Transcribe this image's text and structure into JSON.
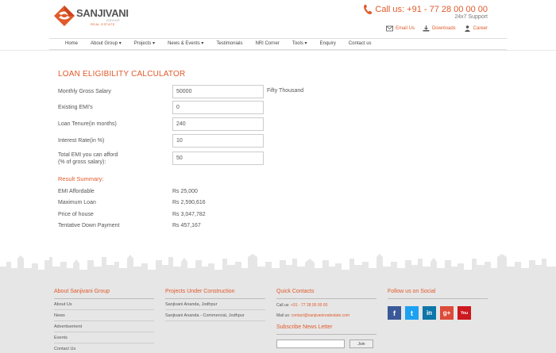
{
  "header": {
    "logo_name": "SANJIVANI",
    "logo_group": "GROUP",
    "logo_sub": "REAL ESTATE",
    "call_label": "Call us: +91 - 77 28 00 00 00",
    "support": "24x7 Support",
    "links": [
      {
        "label": "Email Us",
        "icon": "envelope-icon"
      },
      {
        "label": "Downloads",
        "icon": "download-icon"
      },
      {
        "label": "Career",
        "icon": "user-icon"
      }
    ]
  },
  "nav": [
    "Home",
    "About Group ▾",
    "Projects ▾",
    "News & Events ▾",
    "Testimonials",
    "NRI Corner",
    "Tools ▾",
    "Enquiry",
    "Contact us"
  ],
  "calculator": {
    "title": "LOAN ELIGIBILITY CALCULATOR",
    "fields": [
      {
        "label": "Monthly Gross Salary",
        "value": "50000",
        "words": "Fifty Thousand"
      },
      {
        "label": "Existing EMI's",
        "value": "0",
        "words": ""
      },
      {
        "label": "Loan Tenure(in months)",
        "value": "240",
        "words": ""
      },
      {
        "label": "Interest Rate(in %)",
        "value": "10",
        "words": ""
      },
      {
        "label": "Total EMI you can afford",
        "label2": "(% of gross salary):",
        "value": "50",
        "words": ""
      }
    ],
    "result_title": "Result Summary:",
    "results": [
      {
        "label": "EMI Affordable",
        "value": "Rs 25,000"
      },
      {
        "label": "Maximum Loan",
        "value": "Rs 2,590,616"
      },
      {
        "label": "Price of house",
        "value": "Rs 3,047,782"
      },
      {
        "label": "Tentative Down Payment",
        "value": "Rs 457,167"
      }
    ]
  },
  "footer": {
    "about": {
      "title": "About Sanjivani Group",
      "links": [
        "About Us",
        "News",
        "Advertisement",
        "Events",
        "Contact Us"
      ]
    },
    "projects": {
      "title": "Projects Under Construction",
      "links": [
        "Sanjivani Ananda, Jodhpur",
        "Sanjivani Ananda - Commercial, Jodhpur"
      ]
    },
    "contacts": {
      "title": "Quick Contacts",
      "call_label": "Call us: ",
      "call_value": "+91 - 77 28 00 00 00",
      "mail_label": "Mail us: ",
      "mail_value": "contact@sanjivanirealestate.com",
      "newsletter_title": "Subscribe News Letter",
      "join_label": "Join"
    },
    "social": {
      "title": "Follow us on Social",
      "items": [
        {
          "name": "facebook-icon",
          "glyph": "f",
          "color": "#3b5998"
        },
        {
          "name": "twitter-icon",
          "glyph": "t",
          "color": "#1da1f2"
        },
        {
          "name": "linkedin-icon",
          "glyph": "in",
          "color": "#0e76a8"
        },
        {
          "name": "googleplus-icon",
          "glyph": "g+",
          "color": "#dd4b39"
        },
        {
          "name": "youtube-icon",
          "glyph": "You",
          "color": "#cc181e"
        }
      ]
    }
  },
  "colors": {
    "accent": "#e05a2b",
    "footer_bg": "#e6e6e6"
  }
}
